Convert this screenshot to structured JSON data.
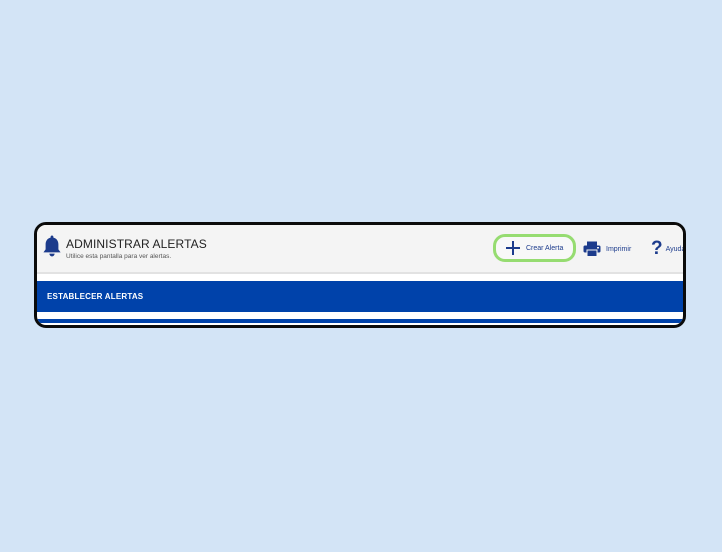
{
  "header": {
    "title": "ADMINISTRAR ALERTAS",
    "subtitle": "Utilice esta pantalla para ver alertas.",
    "icon": "bell-icon"
  },
  "toolbar": {
    "create_label": "Crear Alerta",
    "create_icon": "plus-icon",
    "print_label": "Imprimir",
    "print_icon": "printer-icon",
    "help_label": "Ayuda",
    "help_icon": "help-icon",
    "highlight_color": "#96dc71"
  },
  "section": {
    "title": "ESTABLECER ALERTAS",
    "color": "#0042aa"
  }
}
